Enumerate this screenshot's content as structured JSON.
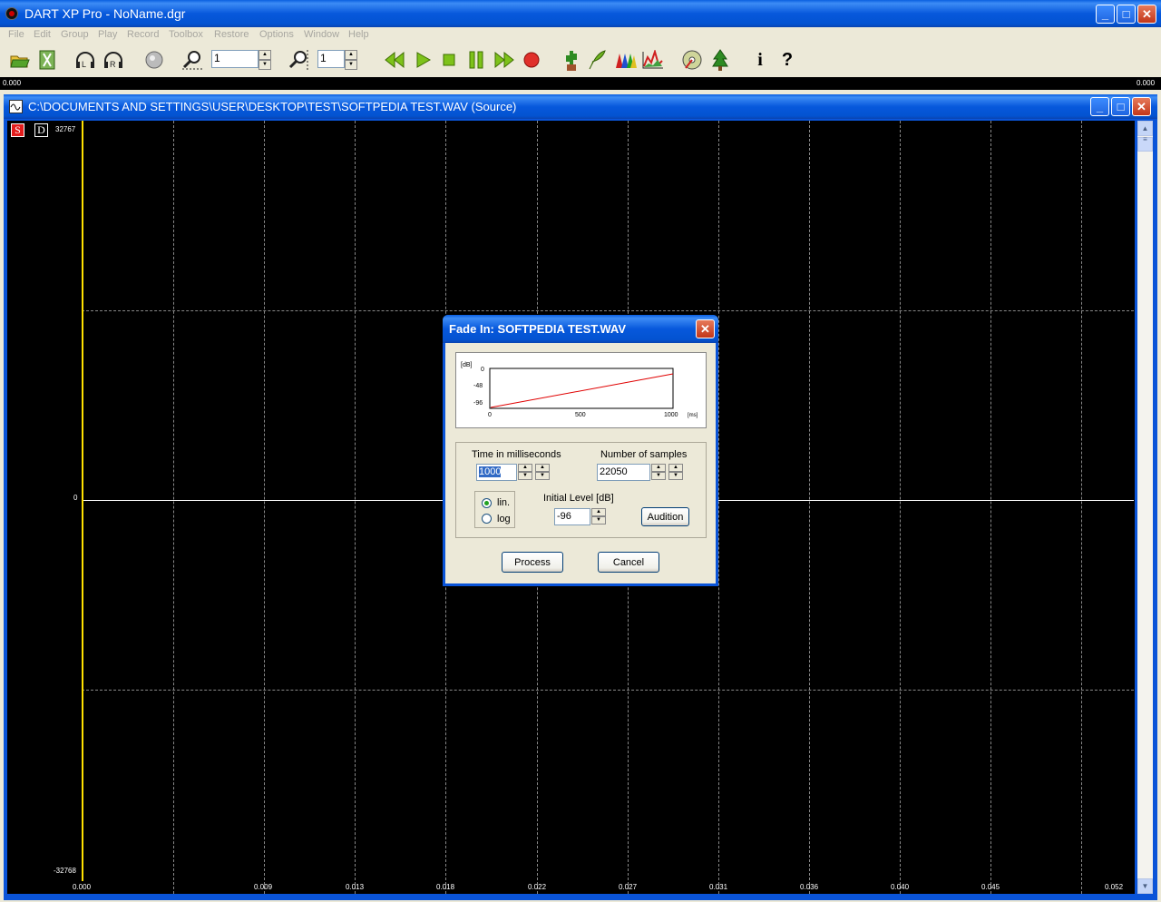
{
  "app": {
    "title": "DART XP Pro - NoName.dgr",
    "window_buttons": {
      "minimize": "_",
      "maximize": "□",
      "close": "✕"
    }
  },
  "menu": [
    "File",
    "Edit",
    "Group",
    "Play",
    "Record",
    "Toolbox",
    "Restore",
    "Options",
    "Window",
    "Help"
  ],
  "toolbar": {
    "zoom_h_value": "1",
    "zoom_v_value": "1",
    "icons": [
      "open-folder-icon",
      "save-icon",
      "headphones-l-icon",
      "headphones-r-icon",
      "stop-circle-icon",
      "zoom-horizontal-icon",
      "zoom-vertical-icon",
      "rewind-icon",
      "play-icon",
      "stop-icon",
      "pause-icon",
      "fast-forward-icon",
      "record-icon",
      "cactus-icon",
      "declick-icon",
      "spectrum-icon",
      "graph-icon",
      "cd-icon",
      "tree-icon",
      "info-icon",
      "help-icon"
    ],
    "info_glyph": "i",
    "help_glyph": "?"
  },
  "time_ruler": {
    "start": "0.000",
    "end": "0.000"
  },
  "source_window": {
    "title": "C:\\DOCUMENTS AND SETTINGS\\USER\\DESKTOP\\TEST\\SOFTPEDIA TEST.WAV (Source)",
    "s_button": "S",
    "d_button": "D",
    "y_labels": {
      "top": "32767",
      "mid": "0",
      "bottom": "-32768"
    },
    "x_labels": [
      "0.000",
      "0.009",
      "0.013",
      "0.018",
      "0.022",
      "0.027",
      "0.031",
      "0.036",
      "0.040",
      "0.045",
      "0.052"
    ],
    "colors": {
      "cursor": "#ffe100",
      "waveform": "#ffffff",
      "background": "#000000"
    }
  },
  "dialog": {
    "title": "Fade In: SOFTPEDIA TEST.WAV",
    "graph": {
      "y_unit": "[dB]",
      "y_ticks": [
        "0",
        "-48",
        "-96"
      ],
      "x_ticks": [
        "0",
        "500",
        "1000"
      ],
      "x_unit": "[ms]",
      "line_color": "#e00000"
    },
    "time_label": "Time in milliseconds",
    "time_value": "1000",
    "samples_label": "Number of samples",
    "samples_value": "22050",
    "lin_label": "lin.",
    "log_label": "log",
    "scale_selected": "lin.",
    "initial_level_label": "Initial Level [dB]",
    "initial_level_value": "-96",
    "audition_label": "Audition",
    "process_label": "Process",
    "cancel_label": "Cancel"
  }
}
